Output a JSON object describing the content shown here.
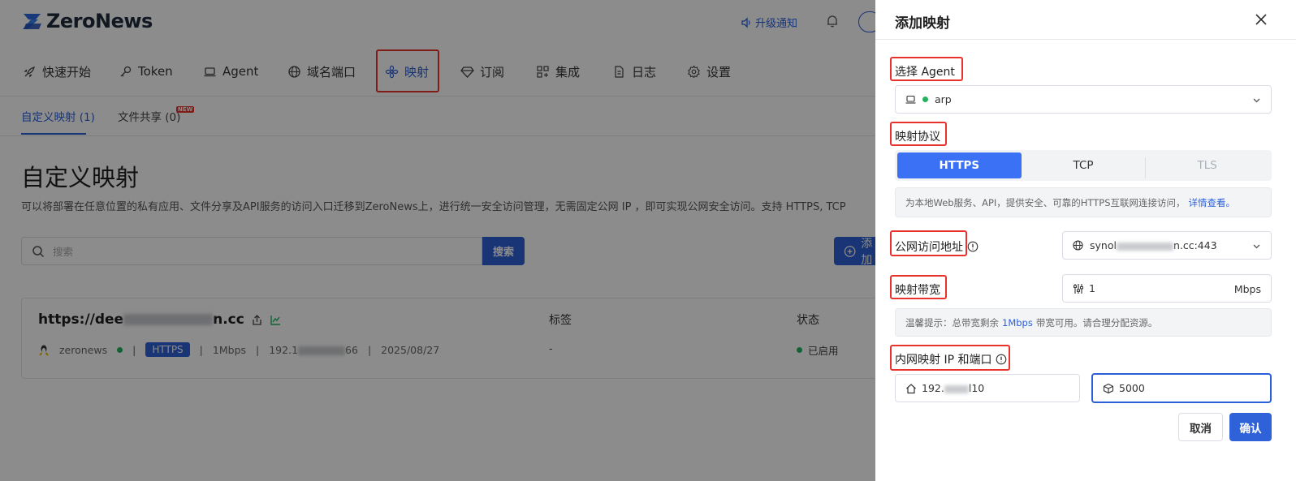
{
  "app": {
    "logo_text": "ZeroNews",
    "upgrade_label": "升级通知"
  },
  "nav": {
    "items": [
      {
        "label": "快速开始",
        "icon": "rocket-icon"
      },
      {
        "label": "Token",
        "icon": "key-icon"
      },
      {
        "label": "Agent",
        "icon": "laptop-icon"
      },
      {
        "label": "域名端口",
        "icon": "globe-icon"
      },
      {
        "label": "映射",
        "icon": "flower-icon",
        "active": true
      },
      {
        "label": "订阅",
        "icon": "diamond-icon"
      },
      {
        "label": "集成",
        "icon": "grid-plus-icon"
      },
      {
        "label": "日志",
        "icon": "file-icon"
      },
      {
        "label": "设置",
        "icon": "gear-icon"
      }
    ]
  },
  "subtabs": [
    {
      "label": "自定义映射 (1)",
      "active": true
    },
    {
      "label": "文件共享 (0)",
      "badge": "NEW"
    }
  ],
  "main": {
    "title": "自定义映射",
    "description": "可以将部署在任意位置的私有应用、文件分享及API服务的访问入口迁移到ZeroNews上，进行统一安全访问管理，无需固定公网 IP ，即可实现公网安全访问。支持 HTTPS, TCP",
    "search_placeholder": "搜索",
    "search_button": "搜索",
    "add_button": "添加"
  },
  "card": {
    "url_prefix": "https://dee",
    "url_suffix": "n.cc",
    "agent": "zeronews",
    "protocol": "HTTPS",
    "bandwidth": "1Mbps",
    "ip_prefix": "192.1",
    "ip_suffix": "66",
    "date": "2025/08/27",
    "tag_header": "标签",
    "tag_value": "-",
    "status_header": "状态",
    "status_value": "已启用"
  },
  "drawer": {
    "title": "添加映射",
    "agent_label": "选择 Agent",
    "agent_value": "arp",
    "protocol_label": "映射协议",
    "protocols": [
      "HTTPS",
      "TCP",
      "TLS"
    ],
    "protocol_hint": "为本地Web服务、API，提供安全、可靠的HTTPS互联网连接访问，",
    "protocol_hint_link": "详情查看。",
    "public_label": "公网访问地址",
    "public_prefix": "synol",
    "public_suffix": "n.cc:443",
    "bandwidth_label": "映射带宽",
    "bandwidth_value": "1",
    "bandwidth_unit": "Mbps",
    "bandwidth_hint_pre": "温馨提示：总带宽剩余",
    "bandwidth_hint_link": "1Mbps",
    "bandwidth_hint_post": "带宽可用。请合理分配资源。",
    "internal_label": "内网映射 IP 和端口",
    "internal_ip_prefix": "192.",
    "internal_ip_suffix": "l10",
    "internal_port": "5000",
    "cancel": "取消",
    "confirm": "确认"
  },
  "colors": {
    "primary": "#2f61d8",
    "highlight": "#e8332d",
    "online": "#22b35e"
  }
}
